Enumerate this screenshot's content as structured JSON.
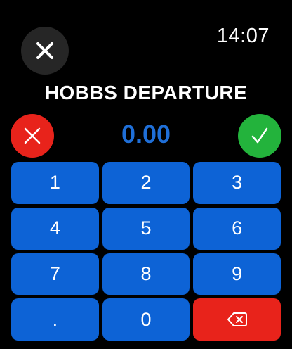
{
  "header": {
    "time": "14:07",
    "close_icon": "close-icon"
  },
  "title": "HOBBS DEPARTURE",
  "actions": {
    "cancel_icon": "close-icon",
    "cancel_color": "#e8231b",
    "confirm_icon": "checkmark-icon",
    "confirm_color": "#23b33c"
  },
  "value_display": "0.00",
  "keypad": {
    "keys": [
      "1",
      "2",
      "3",
      "4",
      "5",
      "6",
      "7",
      "8",
      "9",
      ".",
      "0"
    ],
    "delete_icon": "backspace-icon",
    "key_color": "#0d63d6",
    "delete_color": "#e8231b"
  },
  "colors": {
    "background": "#000000",
    "accent": "#1f6fd8"
  }
}
